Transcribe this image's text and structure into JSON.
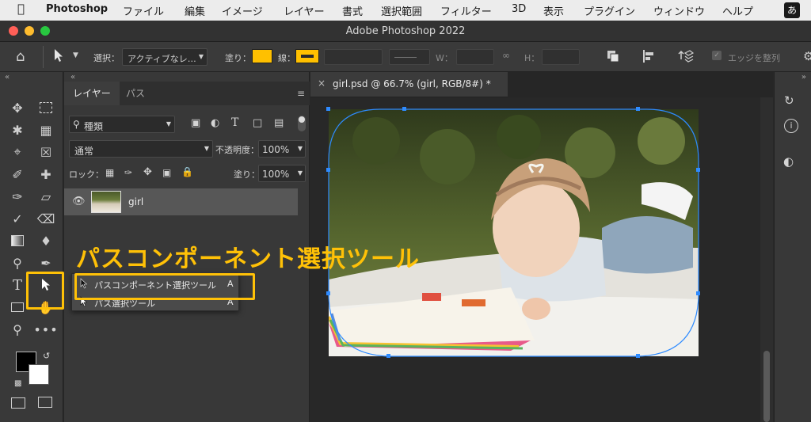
{
  "menubar": {
    "app": "Photoshop",
    "items": [
      "ファイル",
      "編集",
      "イメージ",
      "レイヤー",
      "書式",
      "選択範囲",
      "フィルター",
      "3D",
      "表示",
      "プラグイン",
      "ウィンドウ",
      "ヘルプ"
    ],
    "ime": "あ"
  },
  "window": {
    "title": "Adobe Photoshop 2022"
  },
  "options": {
    "select_label": "選択：",
    "select_value": "アクティブなレ…",
    "fill_label": "塗り：",
    "stroke_label": "線：",
    "w_label": "W：",
    "h_label": "H：",
    "align_edges": "エッジを整列",
    "fill_color": "#ffc000",
    "stroke_color": "#ffc000"
  },
  "layers_panel": {
    "tabs": [
      "レイヤー",
      "パス"
    ],
    "filter_value": "種類",
    "blend_mode": "通常",
    "opacity_label": "不透明度：",
    "opacity_value": "100%",
    "lock_label": "ロック：",
    "fill_label": "塗り：",
    "fill_value": "100%",
    "layer_name": "girl"
  },
  "document": {
    "tab_title": "girl.psd @ 66.7% (girl, RGB/8#) *"
  },
  "annotation": {
    "big_label": "パスコンポーネント選択ツール"
  },
  "flyout": {
    "items": [
      {
        "label": "パスコンポーネント選択ツール",
        "key": "A"
      },
      {
        "label": "パス選択ツール",
        "key": "A"
      }
    ]
  }
}
